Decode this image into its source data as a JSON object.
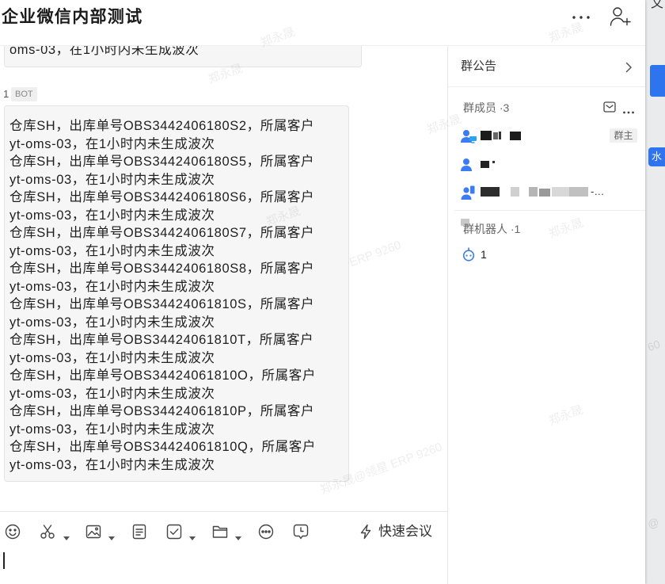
{
  "window": {
    "title": "企业微信内部测试",
    "header_icons": [
      "more-icon",
      "add-person-icon"
    ]
  },
  "chat": {
    "previous_message_tail": "oms-03，在1小时内未生成波次",
    "sender": {
      "name": "1",
      "tag": "BOT"
    },
    "message_lines": [
      "仓库SH，出库单号OBS3442406180S2，所属客户",
      "yt-oms-03，在1小时内未生成波次",
      "仓库SH，出库单号OBS3442406180S5，所属客户",
      "yt-oms-03，在1小时内未生成波次",
      "仓库SH，出库单号OBS3442406180S6，所属客户",
      "yt-oms-03，在1小时内未生成波次",
      "仓库SH，出库单号OBS3442406180S7，所属客户",
      "yt-oms-03，在1小时内未生成波次",
      "仓库SH，出库单号OBS3442406180S8，所属客户",
      "yt-oms-03，在1小时内未生成波次",
      "仓库SH，出库单号OBS34424061810S，所属客户",
      "yt-oms-03，在1小时内未生成波次",
      "仓库SH，出库单号OBS34424061810T，所属客户",
      "yt-oms-03，在1小时内未生成波次",
      "仓库SH，出库单号OBS34424061810O，所属客户",
      "yt-oms-03，在1小时内未生成波次",
      "仓库SH，出库单号OBS34424061810P，所属客户",
      "yt-oms-03，在1小时内未生成波次",
      "仓库SH，出库单号OBS34424061810Q，所属客户",
      "yt-oms-03，在1小时内未生成波次"
    ]
  },
  "composer": {
    "tools": [
      {
        "icon": "emoji-icon"
      },
      {
        "icon": "screenshot-scissors-icon",
        "dropdown": true
      },
      {
        "icon": "image-icon",
        "dropdown": true
      },
      {
        "icon": "document-icon"
      },
      {
        "icon": "todo-checkbox-icon",
        "dropdown": true
      },
      {
        "icon": "folder-icon",
        "dropdown": true
      },
      {
        "icon": "more-options-icon"
      },
      {
        "icon": "scheduled-message-icon"
      }
    ],
    "quick_meeting": {
      "icon": "lightning-icon",
      "label": "快速会议"
    }
  },
  "side_panel": {
    "announcement": {
      "label": "群公告",
      "icon": "chevron-right-icon"
    },
    "members": {
      "label": "群成员 ·3",
      "icons": [
        "mail-icon",
        "more-icon"
      ],
      "list": [
        {
          "icon": "user-desktop-icon",
          "badge": "群主"
        },
        {
          "icon": "user-icon"
        },
        {
          "icon": "user-mobile-icon",
          "name_tail": "-…"
        }
      ]
    },
    "robots": {
      "label": "群机器人 ·1",
      "list": [
        {
          "icon": "robot-icon",
          "name": "1"
        }
      ]
    }
  },
  "watermarks": [
    "郑永晟",
    "郑永晟",
    "郑永晟",
    "郑永晟",
    "ERP 9260",
    "郑永晟",
    "郑永晟",
    "郑永晟",
    "郑永晟@领星 ERP 9260"
  ],
  "background_window": {
    "top_text": "文",
    "button_text": "水",
    "watermark_fragments": [
      "60",
      "@"
    ]
  },
  "colors": {
    "accent": "#3b7bf3",
    "bubble_bg": "#f6f6f6",
    "badge_bg": "#f0f0f0",
    "title": "#1a1a1a",
    "background_window_blue": "#2f74ef"
  }
}
